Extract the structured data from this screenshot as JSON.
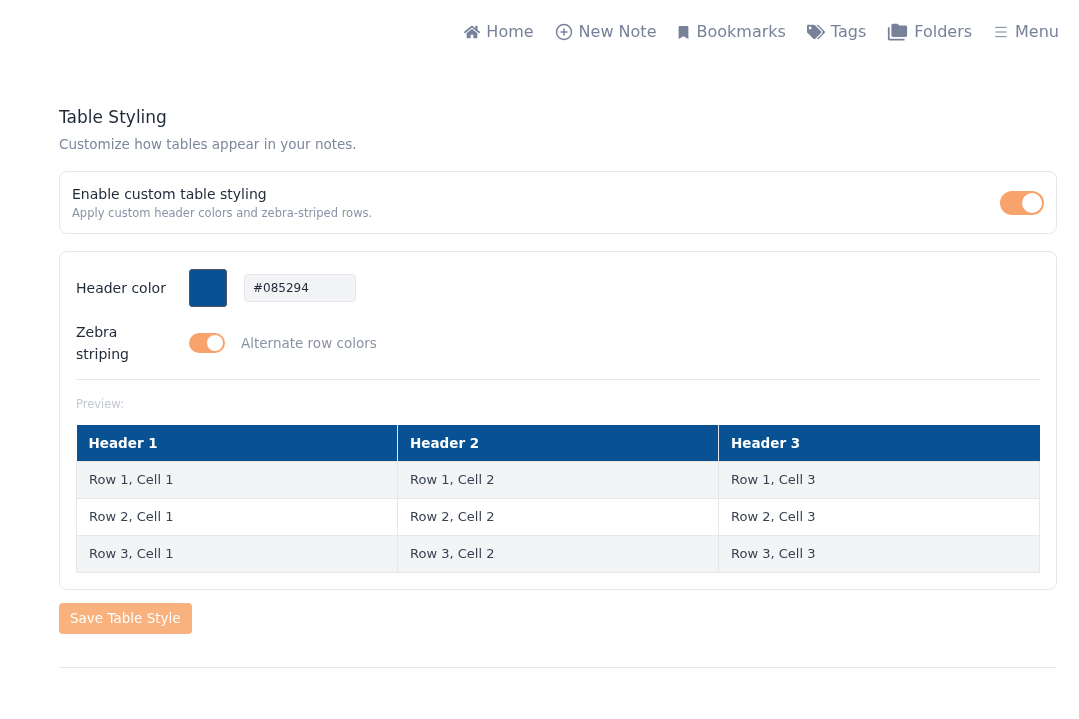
{
  "nav": [
    {
      "label": "Home"
    },
    {
      "label": "New Note"
    },
    {
      "label": "Bookmarks"
    },
    {
      "label": "Tags"
    },
    {
      "label": "Folders"
    },
    {
      "label": "Menu"
    }
  ],
  "section": {
    "title": "Table Styling",
    "subtitle": "Customize how tables appear in your notes."
  },
  "enable_card": {
    "title": "Enable custom table styling",
    "description": "Apply custom header colors and zebra-striped rows.",
    "on": true
  },
  "settings": {
    "header_color": {
      "label": "Header color",
      "value": "#085294"
    },
    "zebra": {
      "label": "Zebra striping",
      "on": true,
      "hint": "Alternate row colors"
    }
  },
  "preview": {
    "label": "Preview:",
    "columns": [
      "Header 1",
      "Header 2",
      "Header 3"
    ],
    "rows": [
      [
        "Row 1, Cell 1",
        "Row 1, Cell 2",
        "Row 1, Cell 3"
      ],
      [
        "Row 2, Cell 1",
        "Row 2, Cell 2",
        "Row 2, Cell 3"
      ],
      [
        "Row 3, Cell 1",
        "Row 3, Cell 2",
        "Row 3, Cell 3"
      ]
    ]
  },
  "save_button": "Save Table Style"
}
